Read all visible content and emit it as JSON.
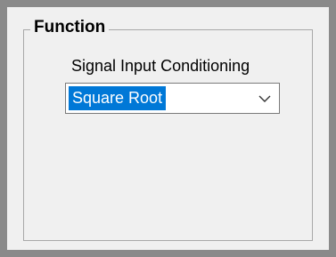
{
  "group": {
    "title": "Function"
  },
  "signal_input": {
    "label": "Signal Input Conditioning",
    "selected_value": "Square Root"
  },
  "icons": {
    "dropdown": "chevron-down-icon"
  },
  "colors": {
    "selection_bg": "#0078d7",
    "selection_text": "#ffffff",
    "window_bg": "#f0f0f0"
  }
}
